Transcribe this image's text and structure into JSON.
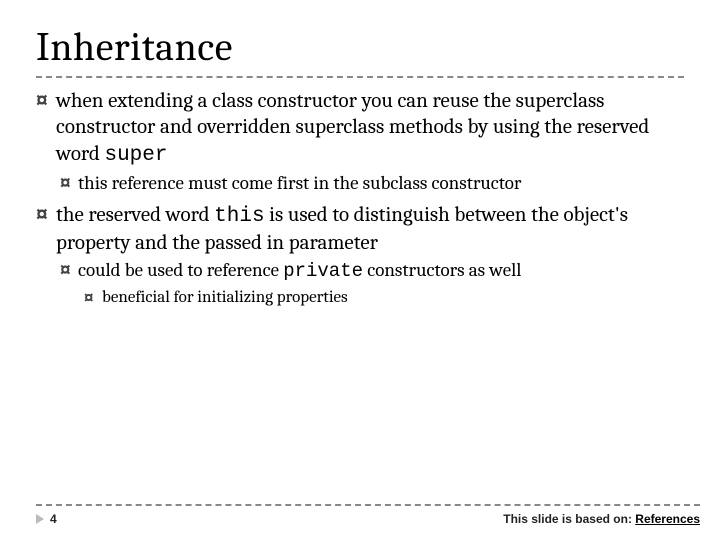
{
  "title": "Inheritance",
  "bullets": {
    "b1_pre": "when extending a class constructor you can reuse the superclass constructor and overridden superclass methods by using the reserved word ",
    "b1_code": "super",
    "b1a": "this reference must come first in the subclass constructor",
    "b2_pre": "the reserved word ",
    "b2_code": "this",
    "b2_post": " is used to distinguish between the object's property and the passed in parameter",
    "b2a_pre": "could be used to reference ",
    "b2a_code": "private",
    "b2a_post": " constructors as well",
    "b2a1": "beneficial for initializing properties"
  },
  "footer": {
    "page": "4",
    "credit_prefix": "This slide is based on: ",
    "credit_link": "References"
  },
  "marker": "¤"
}
